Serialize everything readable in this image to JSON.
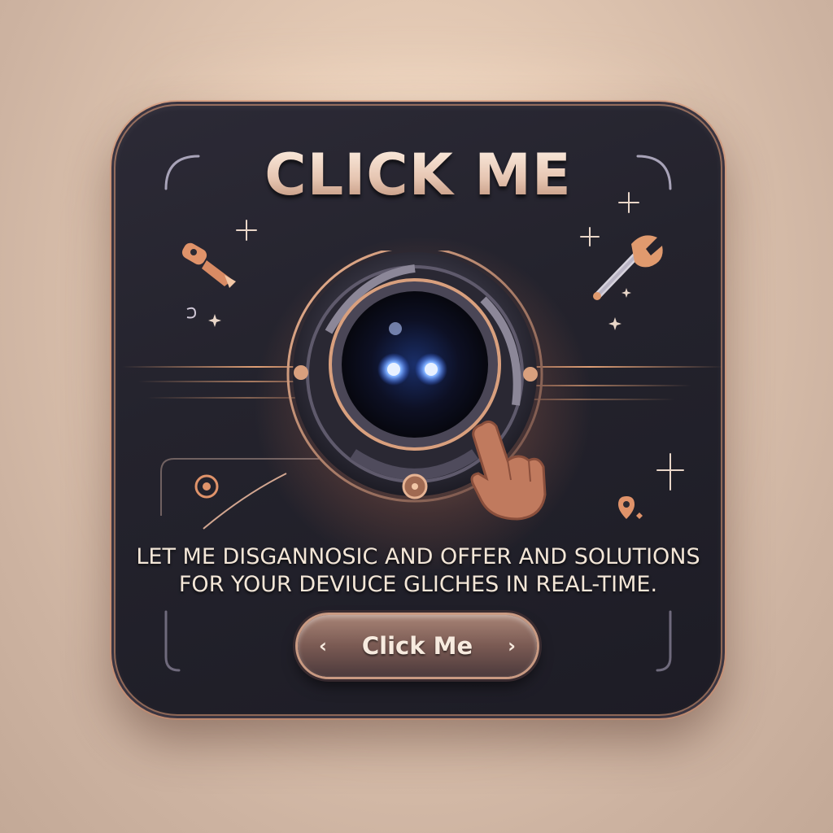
{
  "card": {
    "title": "CLICK ME",
    "description_lines": [
      "LET ME DISGANNOSIC AND OFFER AND SOLUTIONS",
      "FOR YOUR DEVIUCE GLICHES IN REAL-TIME."
    ]
  },
  "button": {
    "label": "Click Me",
    "prev_glyph": "‹",
    "next_glyph": "›"
  },
  "icons": [
    "wrench-icon",
    "screwdriver-icon",
    "location-pin-icon",
    "target-icon",
    "sparkle-icon",
    "robot-lens-icon",
    "pointing-hand-icon"
  ],
  "colors": {
    "card_background": "#24232d",
    "accent_copper": "#d68d6a",
    "text_cream": "#f3e6d7",
    "eye_blue": "#4f8dff"
  }
}
